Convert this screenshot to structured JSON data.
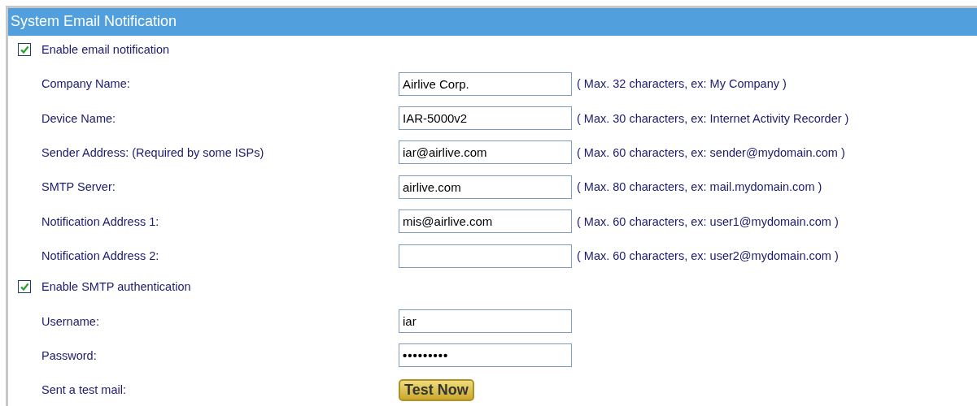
{
  "panel": {
    "title": "System Email Notification"
  },
  "rows": [
    {
      "kind": "checkbox",
      "label": "Enable email notification",
      "checked": true
    },
    {
      "kind": "field",
      "label": "Company Name:",
      "value": "Airlive Corp.",
      "hint": "( Max. 32 characters, ex: My Company )"
    },
    {
      "kind": "field",
      "label": "Device Name:",
      "value": "IAR-5000v2",
      "hint": "( Max. 30 characters, ex: Internet Activity Recorder )"
    },
    {
      "kind": "field",
      "label": "Sender Address: (Required by some ISPs)",
      "value": "iar@airlive.com",
      "hint": "( Max. 60 characters, ex: sender@mydomain.com )"
    },
    {
      "kind": "field",
      "label": "SMTP Server:",
      "value": "airlive.com",
      "hint": "( Max. 80 characters, ex: mail.mydomain.com )"
    },
    {
      "kind": "field",
      "label": "Notification Address 1:",
      "value": "mis@airlive.com",
      "hint": "( Max. 60 characters, ex: user1@mydomain.com )"
    },
    {
      "kind": "field",
      "label": "Notification Address 2:",
      "hint": "( Max. 60 characters, ex: user2@mydomain.com )"
    },
    {
      "kind": "checkbox",
      "label": "Enable SMTP authentication",
      "checked": true
    },
    {
      "kind": "field",
      "label": "Username:",
      "value": "iar"
    },
    {
      "kind": "password",
      "label": "Password:",
      "value": "•••••••••"
    },
    {
      "kind": "button",
      "label": "Sent a test mail:",
      "button": "Test Now"
    }
  ]
}
